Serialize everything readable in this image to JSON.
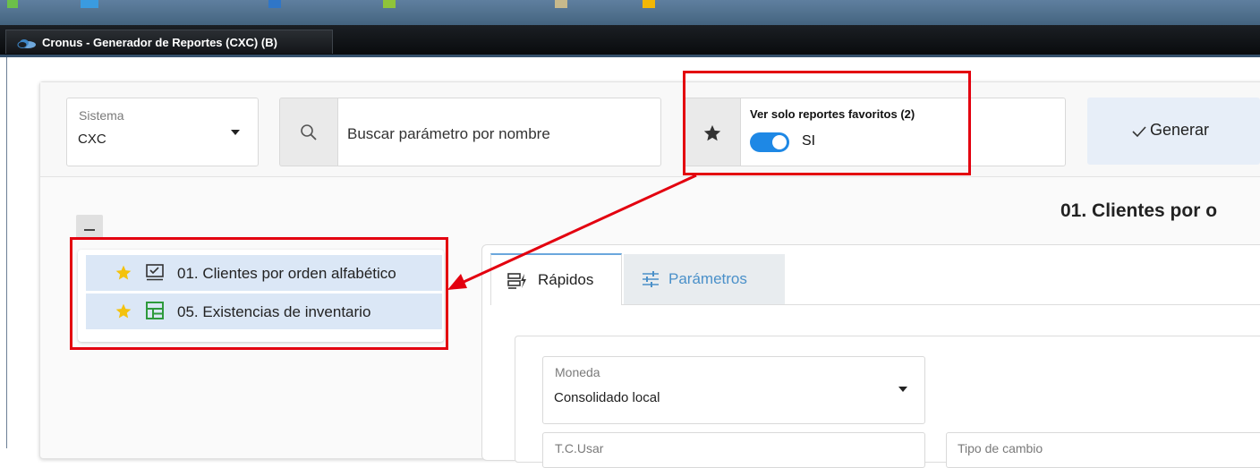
{
  "window": {
    "title": "Cronus - Generador de Reportes (CXC) (B)"
  },
  "toolbar": {
    "sistema_label": "Sistema",
    "sistema_value": "CXC",
    "search_placeholder": "Buscar parámetro por nombre",
    "favorites_label": "Ver solo reportes favoritos (2)",
    "favorites_toggle_text": "SI",
    "favorites_toggle_on": true,
    "generate_label": "Generar"
  },
  "report_list": [
    {
      "label": "01. Clientes por orden alfabético",
      "favorite": true,
      "icon": "list-check-icon"
    },
    {
      "label": "05. Existencias de inventario",
      "favorite": true,
      "icon": "grid-report-icon"
    }
  ],
  "main": {
    "heading": "01. Clientes por o",
    "tabs": [
      {
        "label": "Rápidos",
        "active": true,
        "icon": "quick-report-icon"
      },
      {
        "label": "Parámetros",
        "active": false,
        "icon": "sliders-icon"
      }
    ],
    "fields": {
      "moneda_label": "Moneda",
      "moneda_value": "Consolidado local",
      "tc_usar_label": "T.C.Usar",
      "tipo_cambio_label": "Tipo de cambio"
    }
  },
  "colors": {
    "accent": "#1e88e5",
    "highlight": "#e3000f",
    "star": "#f4c20d",
    "list_selected": "#dbe7f6",
    "tab_link": "#4a90c9"
  }
}
